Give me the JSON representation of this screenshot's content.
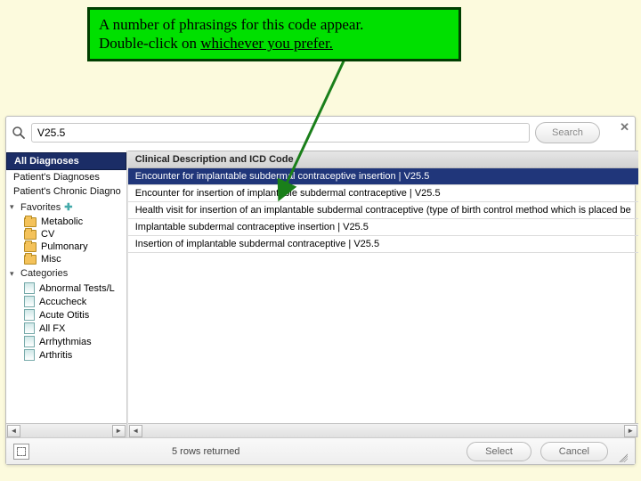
{
  "callout": {
    "line1": "A number of phrasings for this code appear.",
    "line2a": "Double-click on ",
    "line2b": "whichever you prefer."
  },
  "search": {
    "value": "V25.5",
    "button": "Search"
  },
  "sidebar": {
    "selected": "All Diagnoses",
    "items": [
      "Patient's Diagnoses",
      "Patient's Chronic Diagno"
    ],
    "favorites_label": "Favorites",
    "favorites": [
      "Metabolic",
      "CV",
      "Pulmonary",
      "Misc"
    ],
    "categories_label": "Categories",
    "categories": [
      "Abnormal Tests/L",
      "Accucheck",
      "Acute Otitis",
      "All FX",
      "Arrhythmias",
      "Arthritis"
    ]
  },
  "results": {
    "header": "Clinical Description and ICD Code",
    "rows": [
      "Encounter for implantable subdermal contraceptive insertion | V25.5",
      "Encounter for insertion of implantable subdermal contraceptive | V25.5",
      "Health visit for insertion of an implantable subdermal contraceptive (type of birth control method which is placed be",
      "Implantable subdermal contraceptive insertion | V25.5",
      "Insertion of implantable subdermal contraceptive | V25.5"
    ]
  },
  "footer": {
    "status": "5 rows returned",
    "select": "Select",
    "cancel": "Cancel"
  }
}
